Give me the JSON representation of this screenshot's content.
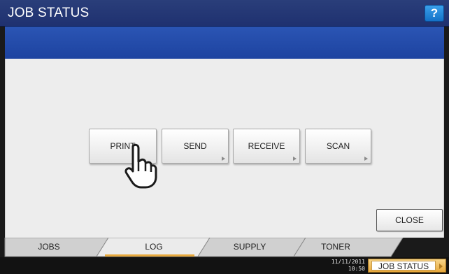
{
  "header": {
    "title": "JOB STATUS",
    "help_label": "?"
  },
  "log_buttons": [
    {
      "label": "PRINT"
    },
    {
      "label": "SEND"
    },
    {
      "label": "RECEIVE"
    },
    {
      "label": "SCAN"
    }
  ],
  "close_label": "CLOSE",
  "tabs": [
    {
      "label": "JOBS",
      "active": false
    },
    {
      "label": "LOG",
      "active": true
    },
    {
      "label": "SUPPLY",
      "active": false
    },
    {
      "label": "TONER",
      "active": false
    }
  ],
  "status_bar": {
    "date": "11/11/2011",
    "time": "10:50",
    "job_status_label": "JOB STATUS"
  },
  "colors": {
    "title_bar": "#1f3170",
    "band": "#2148a8",
    "active_tab_underline": "#e8a93c"
  }
}
